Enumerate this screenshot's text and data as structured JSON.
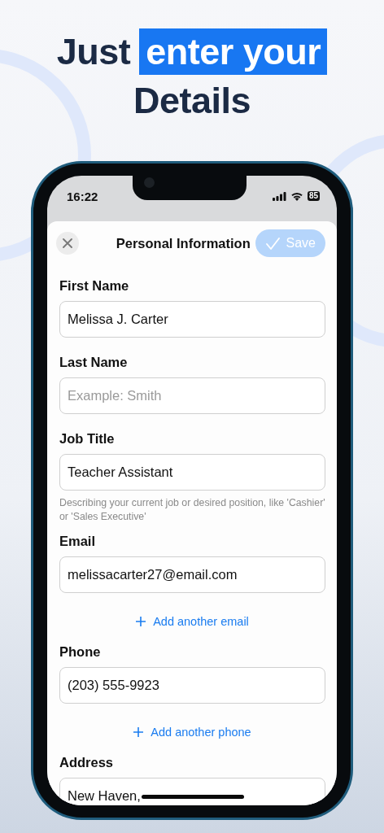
{
  "headline": {
    "line_1_plain": "Just",
    "line_1_highlight": "enter your",
    "line_2": "Details"
  },
  "status_bar": {
    "time": "16:22",
    "battery": "85"
  },
  "sheet": {
    "title": "Personal Information",
    "save_button": {
      "label": "Save",
      "disabled": true
    }
  },
  "form": [
    {
      "kind": "field",
      "label": "First Name",
      "value": "Melissa J. Carter"
    },
    {
      "kind": "field",
      "label": "Last Name",
      "placeholder": "Example: Smith"
    },
    {
      "kind": "field",
      "label": "Job Title",
      "value": "Teacher Assistant",
      "hint": "Describing your current job or desired position, like 'Cashier' or 'Sales Executive'"
    },
    {
      "kind": "field",
      "label": "Email",
      "value": "melissacarter27@email.com"
    },
    {
      "kind": "link",
      "label": "Add another email"
    },
    {
      "kind": "field",
      "label": "Phone",
      "value": "(203) 555-9923"
    },
    {
      "kind": "link",
      "label": "Add another phone"
    },
    {
      "kind": "field",
      "label": "Address",
      "value": "New Haven,"
    }
  ]
}
